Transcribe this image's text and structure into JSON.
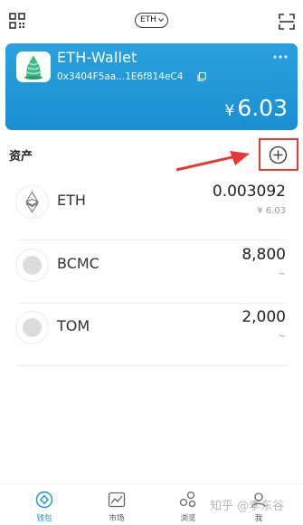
{
  "topbar": {
    "network": "ETH",
    "scan_icon": "qr-scan-icon",
    "scan_frame_icon": "scan-frame-icon"
  },
  "wallet": {
    "name": "ETH-Wallet",
    "address": "0x3404F5aa...1E6f814eC4",
    "currency_symbol": "¥",
    "balance": "6.03",
    "logo_icon": "cone-shell-logo-icon",
    "more_icon": "more-dots-icon",
    "copy_icon": "copy-icon",
    "card_color": "#1b8fd2"
  },
  "assets": {
    "title": "资产",
    "add_icon": "add-circle-icon",
    "annotation_color": "#e53935",
    "items": [
      {
        "symbol": "ETH",
        "amount": "0.003092",
        "fiat": "¥ 6.03",
        "icon": "ethereum-icon"
      },
      {
        "symbol": "BCMC",
        "amount": "8,800",
        "fiat": "~",
        "icon": "grey-token-icon"
      },
      {
        "symbol": "TOM",
        "amount": "2,000",
        "fiat": "~",
        "icon": "grey-token-icon"
      }
    ]
  },
  "tabbar": {
    "active_color": "#1b8fd2",
    "tabs": [
      {
        "label": "钱包",
        "icon": "wallet-icon",
        "active": true
      },
      {
        "label": "市场",
        "icon": "market-chart-icon",
        "active": false
      },
      {
        "label": "浏览",
        "icon": "browse-bubbles-icon",
        "active": false
      },
      {
        "label": "我",
        "icon": "profile-icon",
        "active": false
      }
    ]
  },
  "watermark": "知乎 @李东谷"
}
